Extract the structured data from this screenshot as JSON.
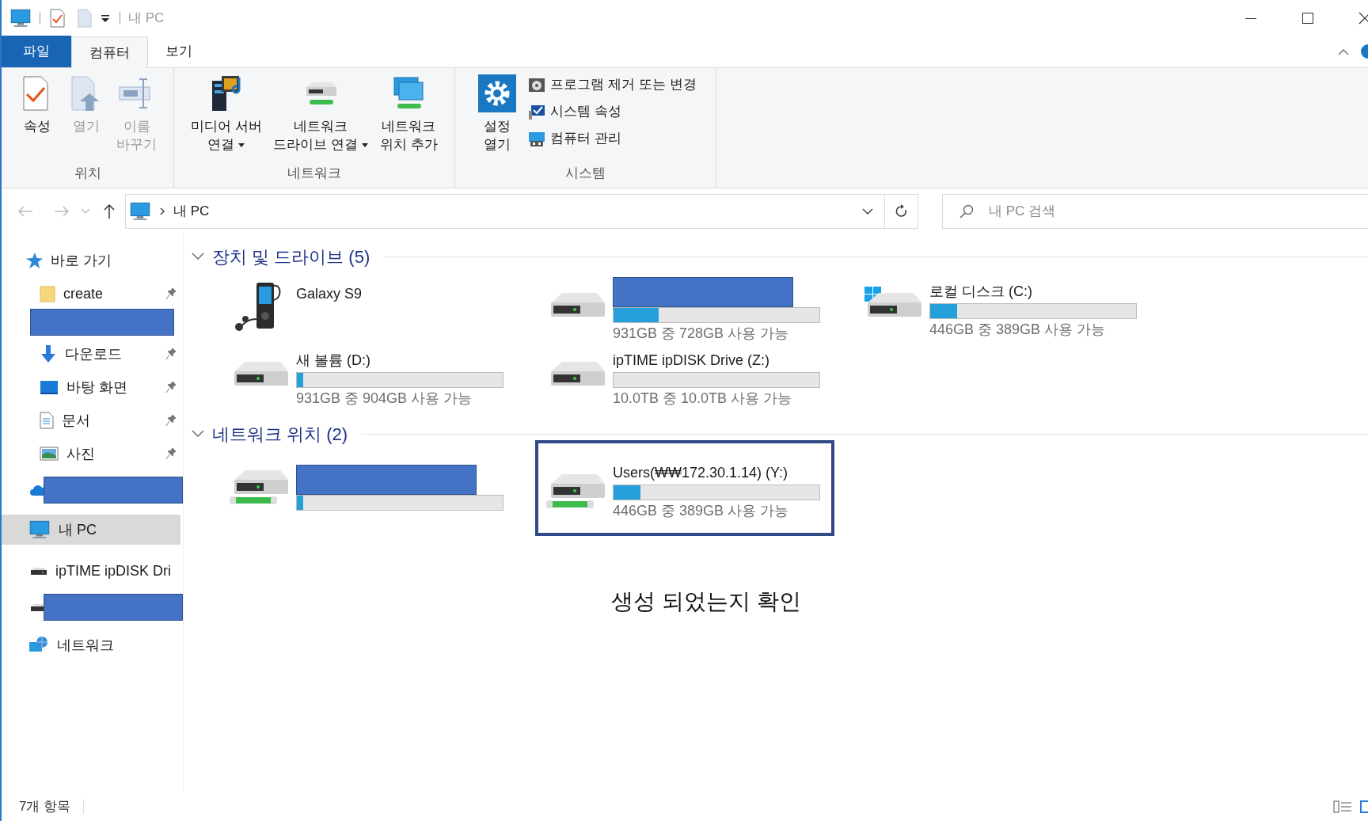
{
  "window": {
    "title": "내 PC"
  },
  "ribbon_tabs": [
    {
      "label": "파일",
      "kind": "file",
      "selected": false
    },
    {
      "label": "컴퓨터",
      "kind": "tab",
      "selected": true
    },
    {
      "label": "보기",
      "kind": "tab",
      "selected": false
    }
  ],
  "ribbon_groups": [
    {
      "label": "위치",
      "commands": [
        {
          "kind": "large",
          "lines": [
            "속성"
          ],
          "disabled": false,
          "dropdown": false
        },
        {
          "kind": "large",
          "lines": [
            "열기"
          ],
          "disabled": true,
          "dropdown": false
        },
        {
          "kind": "large",
          "lines": [
            "이름",
            "바꾸기"
          ],
          "disabled": true,
          "dropdown": false
        }
      ]
    },
    {
      "label": "네트워크",
      "commands": [
        {
          "kind": "large",
          "lines": [
            "미디어 서버",
            "연결"
          ],
          "disabled": false,
          "dropdown": true
        },
        {
          "kind": "large",
          "lines": [
            "네트워크",
            "드라이브 연결"
          ],
          "disabled": false,
          "dropdown": true
        },
        {
          "kind": "large",
          "lines": [
            "네트워크",
            "위치 추가"
          ],
          "disabled": false,
          "dropdown": false
        }
      ]
    },
    {
      "label": "시스템",
      "commands": [
        {
          "kind": "large",
          "lines": [
            "설정",
            "열기"
          ],
          "disabled": false,
          "dropdown": false
        },
        {
          "kind": "small",
          "lines": [
            "프로그램 제거 또는 변경"
          ],
          "disabled": false,
          "dropdown": false
        },
        {
          "kind": "small",
          "lines": [
            "시스템 속성"
          ],
          "disabled": false,
          "dropdown": false
        },
        {
          "kind": "small",
          "lines": [
            "컴퓨터 관리"
          ],
          "disabled": false,
          "dropdown": false
        }
      ]
    }
  ],
  "address_bar": {
    "path": "내 PC"
  },
  "search": {
    "placeholder": "내 PC 검색"
  },
  "sidebar": {
    "items": [
      {
        "kind": "item",
        "label": "바로 가기",
        "pinned": false,
        "selected": false
      },
      {
        "kind": "item",
        "label": "create",
        "pinned": true,
        "selected": false
      },
      {
        "kind": "redacted",
        "pinned": false,
        "selected": false
      },
      {
        "kind": "item",
        "label": "다운로드",
        "pinned": true,
        "selected": false
      },
      {
        "kind": "item",
        "label": "바탕 화면",
        "pinned": true,
        "selected": false
      },
      {
        "kind": "item",
        "label": "문서",
        "pinned": true,
        "selected": false
      },
      {
        "kind": "item",
        "label": "사진",
        "pinned": true,
        "selected": false
      },
      {
        "kind": "redacted",
        "pinned": false,
        "selected": false
      },
      {
        "kind": "item",
        "label": "내 PC",
        "pinned": false,
        "selected": true
      },
      {
        "kind": "item",
        "label": "ipTIME ipDISK Dri",
        "pinned": false,
        "selected": false
      },
      {
        "kind": "redacted",
        "pinned": false,
        "selected": false
      },
      {
        "kind": "item",
        "label": "네트워크",
        "pinned": false,
        "selected": false
      }
    ]
  },
  "sections": [
    {
      "title": "장치 및 드라이브 (5)",
      "expanded": true,
      "items": [
        {
          "kind": "device",
          "name": "Galaxy S9",
          "highlighted": false
        },
        {
          "kind": "drive",
          "redacted": true,
          "level": 0.22,
          "free": "931GB 중 728GB 사용 가능",
          "highlighted": false
        },
        {
          "kind": "system-drive",
          "name": "로컬 디스크 (C:)",
          "level": 0.13,
          "free": "446GB 중 389GB 사용 가능",
          "highlighted": false
        },
        {
          "kind": "drive",
          "name": "새 볼륨 (D:)",
          "level": 0.03,
          "free": "931GB 중 904GB 사용 가능",
          "highlighted": false
        },
        {
          "kind": "drive",
          "name": "ipTIME ipDISK Drive (Z:)",
          "level": 0,
          "free": "10.0TB 중 10.0TB 사용 가능",
          "highlighted": false
        }
      ]
    },
    {
      "title": "네트워크 위치 (2)",
      "expanded": true,
      "items": [
        {
          "kind": "network-drive",
          "redacted": true,
          "level": 0.03,
          "highlighted": false
        },
        {
          "kind": "network-drive",
          "name": "Users(₩₩172.30.1.14) (Y:)",
          "level": 0.13,
          "free": "446GB 중 389GB 사용 가능",
          "highlighted": true
        }
      ]
    }
  ],
  "caption": "생성 되었는지 확인",
  "status_bar": {
    "item_count": "7개 항목"
  }
}
